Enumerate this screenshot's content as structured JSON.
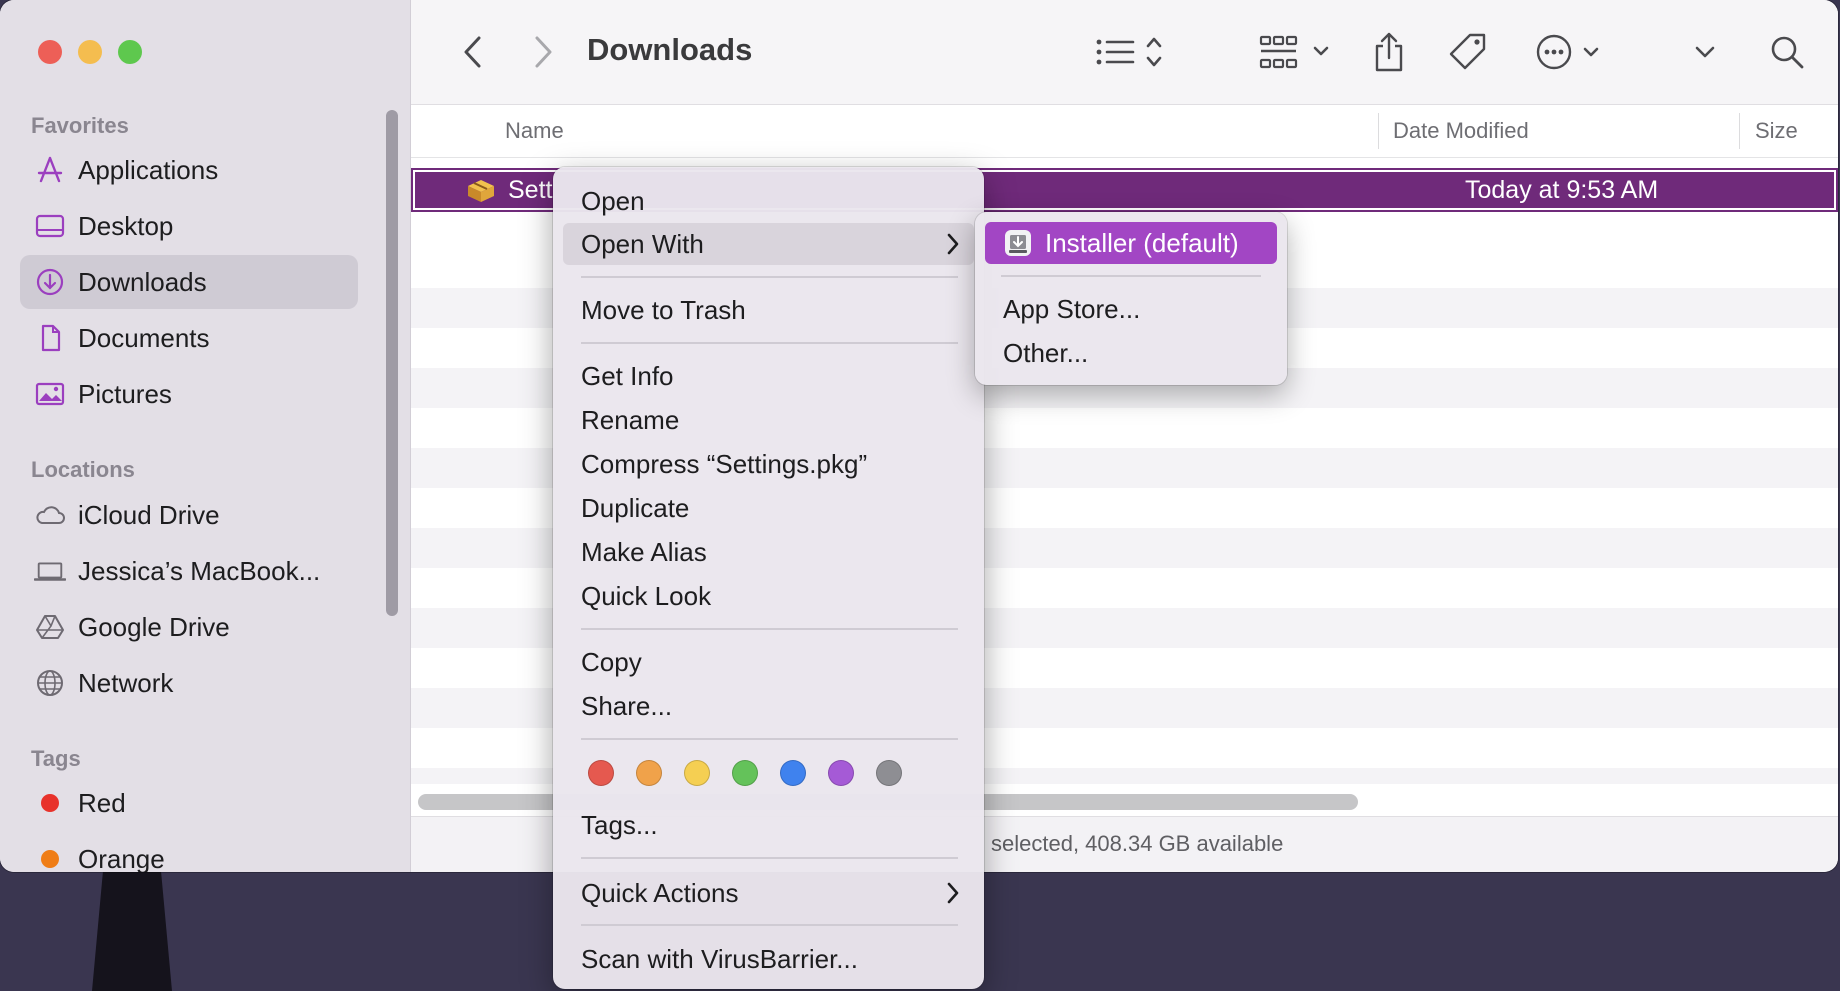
{
  "window": {
    "title": "Downloads"
  },
  "sidebar": {
    "sections": [
      {
        "heading": "Favorites",
        "items": [
          {
            "label": "Applications",
            "icon": "applications-icon"
          },
          {
            "label": "Desktop",
            "icon": "desktop-icon"
          },
          {
            "label": "Downloads",
            "icon": "downloads-icon",
            "selected": true
          },
          {
            "label": "Documents",
            "icon": "documents-icon"
          },
          {
            "label": "Pictures",
            "icon": "pictures-icon"
          }
        ]
      },
      {
        "heading": "Locations",
        "items": [
          {
            "label": "iCloud Drive",
            "icon": "icloud-icon"
          },
          {
            "label": "Jessica’s MacBook...",
            "icon": "laptop-icon"
          },
          {
            "label": "Google Drive",
            "icon": "google-drive-icon"
          },
          {
            "label": "Network",
            "icon": "network-icon"
          }
        ]
      },
      {
        "heading": "Tags",
        "items": [
          {
            "label": "Red",
            "color": "#e8322b"
          },
          {
            "label": "Orange",
            "color": "#ef7d16"
          }
        ]
      }
    ]
  },
  "columns": {
    "name": "Name",
    "date_modified": "Date Modified",
    "size": "Size"
  },
  "files": [
    {
      "name": "Sett",
      "date_modified": "Today at 9:53 AM",
      "selected": true
    }
  ],
  "status": {
    "text": "selected, 408.34 GB available"
  },
  "context_menu": {
    "open": "Open",
    "open_with": "Open With",
    "move_to_trash": "Move to Trash",
    "get_info": "Get Info",
    "rename": "Rename",
    "compress": "Compress “Settings.pkg”",
    "duplicate": "Duplicate",
    "make_alias": "Make Alias",
    "quick_look": "Quick Look",
    "copy": "Copy",
    "share": "Share...",
    "tag_colors": [
      "#e5594f",
      "#f0a24a",
      "#f5cf52",
      "#64c25a",
      "#3f82ee",
      "#a55ad6",
      "#8e8e93"
    ],
    "tags": "Tags...",
    "quick_actions": "Quick Actions",
    "scan": "Scan with VirusBarrier..."
  },
  "open_with_submenu": {
    "installer": "Installer (default)",
    "app_store": "App Store...",
    "other": "Other..."
  },
  "colors": {
    "selection": "#6f2a7a",
    "submenu_highlight": "#a246c4"
  }
}
